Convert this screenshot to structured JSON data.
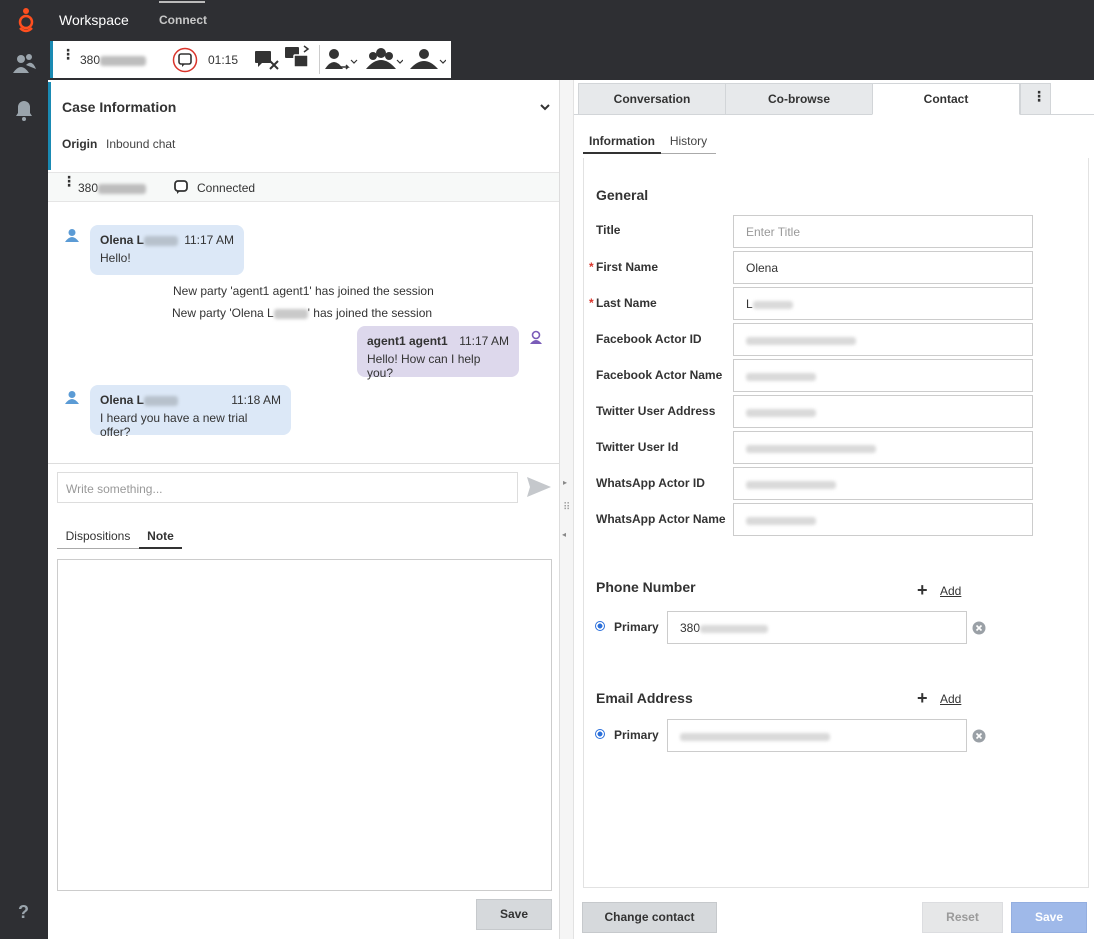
{
  "app": {
    "title": "Workspace",
    "nav_connect": "Connect"
  },
  "toolbar": {
    "number_prefix": "380",
    "timer": "01:15"
  },
  "case": {
    "title": "Case Information",
    "origin_label": "Origin",
    "origin_value": "Inbound chat"
  },
  "party": {
    "number_prefix": "380",
    "status": "Connected"
  },
  "chat": {
    "m1": {
      "name": "Olena L",
      "time": "11:17 AM",
      "text": "Hello!"
    },
    "sys1": "New party 'agent1 agent1' has joined the session",
    "sys2_a": "New party 'Olena L",
    "sys2_b": "' has joined the session",
    "m2": {
      "name": "agent1 agent1",
      "time": "11:17 AM",
      "text": "Hello! How can I help you?"
    },
    "m3": {
      "name": "Olena L",
      "time": "11:18 AM",
      "text": "I heard you have a new trial offer?"
    }
  },
  "compose": {
    "placeholder": "Write something..."
  },
  "bottom_tabs": {
    "dispositions": "Dispositions",
    "note": "Note"
  },
  "note_save": "Save",
  "right_tabs": {
    "conversation": "Conversation",
    "cobrowse": "Co-browse",
    "contact": "Contact"
  },
  "sub_tabs": {
    "information": "Information",
    "history": "History"
  },
  "general": {
    "heading": "General",
    "title_label": "Title",
    "title_placeholder": "Enter Title",
    "first_name_label": "First Name",
    "first_name_value": "Olena",
    "last_name_label": "Last Name",
    "last_name_value": "L",
    "facebook_actor_id_label": "Facebook Actor ID",
    "facebook_actor_name_label": "Facebook Actor Name",
    "twitter_user_address_label": "Twitter User Address",
    "twitter_user_id_label": "Twitter User Id",
    "whatsapp_actor_id_label": "WhatsApp Actor ID",
    "whatsapp_actor_name_label": "WhatsApp Actor Name"
  },
  "phone": {
    "heading": "Phone Number",
    "add": "Add",
    "primary_label": "Primary",
    "value_prefix": "380"
  },
  "email": {
    "heading": "Email Address",
    "add": "Add",
    "primary_label": "Primary"
  },
  "footer": {
    "change_contact": "Change contact",
    "reset": "Reset",
    "save": "Save"
  },
  "colors": {
    "accent": "#1a8ab3",
    "topbar": "#2e2f33",
    "customer_bubble": "#dce8f7",
    "agent_bubble": "#ddd8ec",
    "required": "#d9342b",
    "save_disabled": "#9fb9e9"
  }
}
